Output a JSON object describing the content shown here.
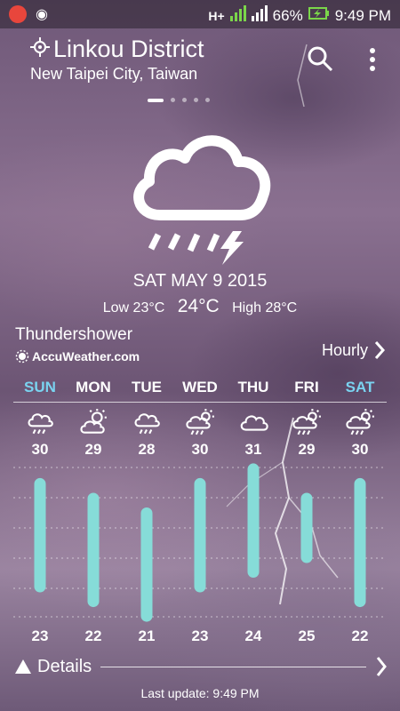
{
  "status_bar": {
    "network_type": "H+",
    "battery": "66%",
    "time": "9:49 PM"
  },
  "location": {
    "district": "Linkou District",
    "region": "New Taipei City, Taiwan"
  },
  "page_count": 5,
  "active_page": 0,
  "current": {
    "date": "SAT MAY 9 2015",
    "low_label": "Low 23°C",
    "temp": "24°C",
    "high_label": "High 28°C",
    "condition": "Thundershower",
    "icon": "thundershower-icon"
  },
  "provider": "AccuWeather.com",
  "hourly_label": "Hourly",
  "colors": {
    "weekend": "#7ad3f0",
    "bar": "#86dcd8"
  },
  "forecast": [
    {
      "day": "SUN",
      "icon": "cloud-rain-icon",
      "high": "30",
      "low": "23",
      "weekend": true
    },
    {
      "day": "MON",
      "icon": "partly-sunny-icon",
      "high": "29",
      "low": "22",
      "weekend": false
    },
    {
      "day": "TUE",
      "icon": "cloud-rain-icon",
      "high": "28",
      "low": "21",
      "weekend": false
    },
    {
      "day": "WED",
      "icon": "sun-cloud-rain-icon",
      "high": "30",
      "low": "23",
      "weekend": false
    },
    {
      "day": "THU",
      "icon": "cloud-icon",
      "high": "31",
      "low": "24",
      "weekend": false
    },
    {
      "day": "FRI",
      "icon": "sun-cloud-rain-icon",
      "high": "29",
      "low": "25",
      "weekend": false
    },
    {
      "day": "SAT",
      "icon": "sun-cloud-rain-icon",
      "high": "30",
      "low": "22",
      "weekend": true
    }
  ],
  "details_label": "Details",
  "last_update": "Last update: 9:49 PM"
}
